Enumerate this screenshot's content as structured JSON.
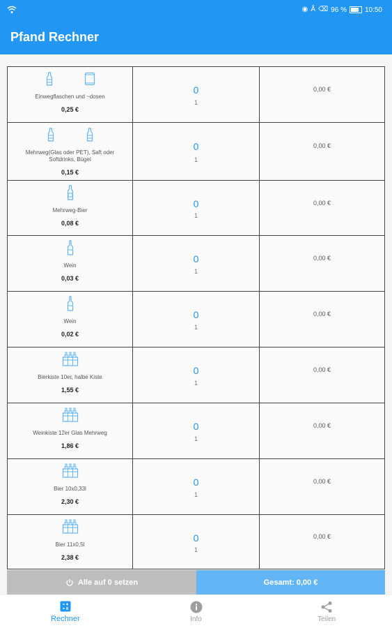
{
  "status_bar": {
    "battery": "96 %",
    "time": "10:50"
  },
  "app": {
    "title": "Pfand Rechner"
  },
  "colors": {
    "primary": "#2196f3",
    "accent_light": "#64b5f6",
    "reset_gray": "#bdbdbd"
  },
  "items": [
    {
      "description": "Einwegflaschen und ~dosen",
      "price": "0,25 €",
      "count": "0",
      "unit": "1",
      "sum": "0,00 €",
      "icons": [
        "bottle-icon",
        "can-icon"
      ]
    },
    {
      "description": "Mehrweg(Glas oder PET), Saft oder Softdrinks, Bügel",
      "price": "0,15 €",
      "count": "0",
      "unit": "1",
      "sum": "0,00 €",
      "icons": [
        "bottle-icon",
        "bottle-icon"
      ]
    },
    {
      "description": "Mehrweg-Bier",
      "price": "0,08 €",
      "count": "0",
      "unit": "1",
      "sum": "0,00 €",
      "icons": [
        "beer-bottle-icon"
      ]
    },
    {
      "description": "Wein",
      "price": "0,03 €",
      "count": "0",
      "unit": "1",
      "sum": "0,00 €",
      "icons": [
        "wine-bottle-icon"
      ]
    },
    {
      "description": "Wein",
      "price": "0,02 €",
      "count": "0",
      "unit": "1",
      "sum": "0,00 €",
      "icons": [
        "wine-bottle-icon"
      ]
    },
    {
      "description": "Bierkiste 10er, halbe Kiste",
      "price": "1,55 €",
      "count": "0",
      "unit": "1",
      "sum": "0,00 €",
      "icons": [
        "crate-icon"
      ]
    },
    {
      "description": "Weinkiste 12er Glas Mehrweg",
      "price": "1,86 €",
      "count": "0",
      "unit": "1",
      "sum": "0,00 €",
      "icons": [
        "crate-icon"
      ]
    },
    {
      "description": "Bier 10x0,33l",
      "price": "2,30 €",
      "count": "0",
      "unit": "1",
      "sum": "0,00 €",
      "icons": [
        "crate-icon"
      ]
    },
    {
      "description": "Bier 11x0,5l",
      "price": "2,38 €",
      "count": "0",
      "unit": "1",
      "sum": "0,00 €",
      "icons": [
        "crate-icon"
      ]
    }
  ],
  "buttons": {
    "reset": "Alle auf 0 setzen",
    "total": "Gesamt: 0,00 €"
  },
  "nav": [
    {
      "label": "Rechner",
      "icon": "calculator-icon",
      "active": true
    },
    {
      "label": "Info",
      "icon": "info-icon",
      "active": false
    },
    {
      "label": "Teilen",
      "icon": "share-icon",
      "active": false
    }
  ]
}
